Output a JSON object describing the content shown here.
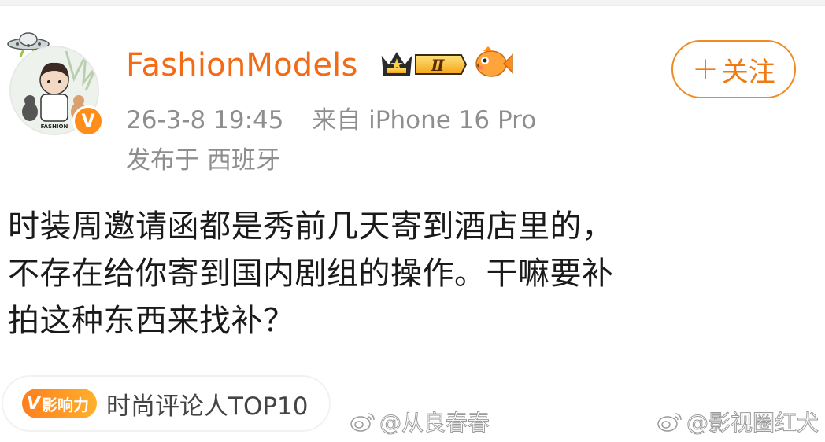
{
  "user": {
    "name": "FashionModels",
    "level_badge": "Ⅱ",
    "verified_mark": "V"
  },
  "follow_button": {
    "plus": "+",
    "label": "关注"
  },
  "meta": {
    "time": "26-3-8 19:45",
    "source": "来自 iPhone 16 Pro",
    "location": "发布于 西班牙"
  },
  "post": {
    "lines": [
      "时装周邀请函都是秀前几天寄到酒店里的，",
      "不存在给你寄到国内剧组的操作。干嘛要补",
      "拍这种东西来找补？"
    ]
  },
  "influence": {
    "badge_v": "V",
    "badge_label": "影响力",
    "text": "时尚评论人TOP10"
  },
  "watermarks": [
    "@从良春春",
    "@影视圈红犬"
  ],
  "colors": {
    "brand_orange": "#f26b16",
    "meta_gray": "#8e8e8e",
    "badge_orange": "#ff8d1a"
  },
  "icons": [
    "ufo-icon",
    "avatar-image",
    "verified-icon",
    "crown-level-icon",
    "fish-icon",
    "weibo-watermark-icon"
  ]
}
